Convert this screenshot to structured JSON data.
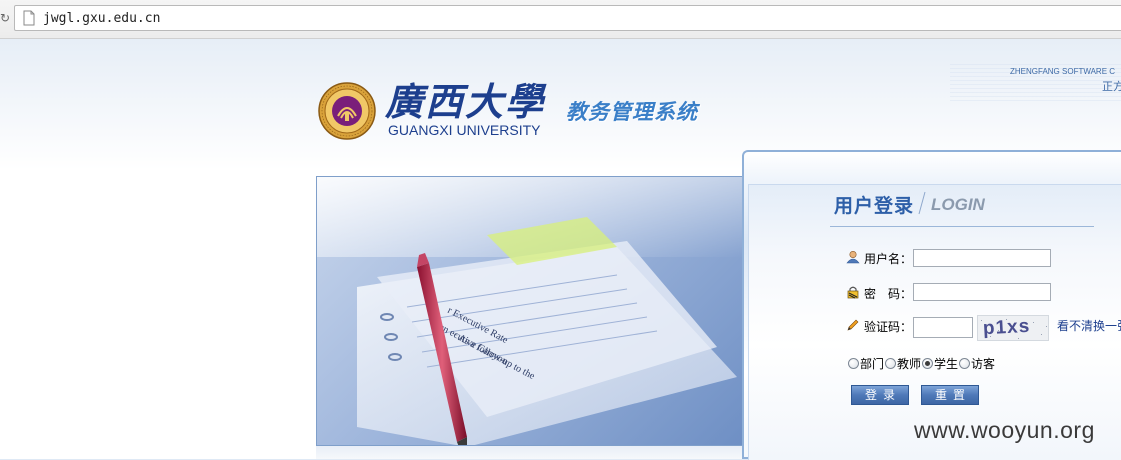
{
  "browser": {
    "url": "jwgl.gxu.edu.cn"
  },
  "brand": {
    "company_en": "ZHENGFANG SOFTWARE C",
    "company_cn": "正方"
  },
  "logo": {
    "name_cn": "廣西大學",
    "name_en": "GUANGXI UNIVERSITY",
    "system_title": "教务管理系统"
  },
  "login": {
    "title_cn": "用户登录",
    "title_en": "LOGIN",
    "username_label": "用户名：",
    "username_value": "",
    "password_label": "密　码：",
    "password_value": "",
    "captcha_label": "验证码：",
    "captcha_value": "",
    "captcha_image_text": "p1xs",
    "captcha_refresh_link": "看不清换一张",
    "roles": [
      {
        "label": "部门",
        "checked": false
      },
      {
        "label": "教师",
        "checked": false
      },
      {
        "label": "学生",
        "checked": true
      },
      {
        "label": "访客",
        "checked": false
      }
    ],
    "login_button": "登录",
    "reset_button": "重置"
  },
  "hero": {
    "doc_lines": [
      "Executive Rate",
      "Executive Carryon",
      "As a follow-up to the"
    ]
  },
  "watermark": "www.wooyun.org",
  "colors": {
    "brand_blue": "#1d3f8e",
    "title_blue": "#2d5fa8",
    "button_blue": "#4f79b8"
  }
}
